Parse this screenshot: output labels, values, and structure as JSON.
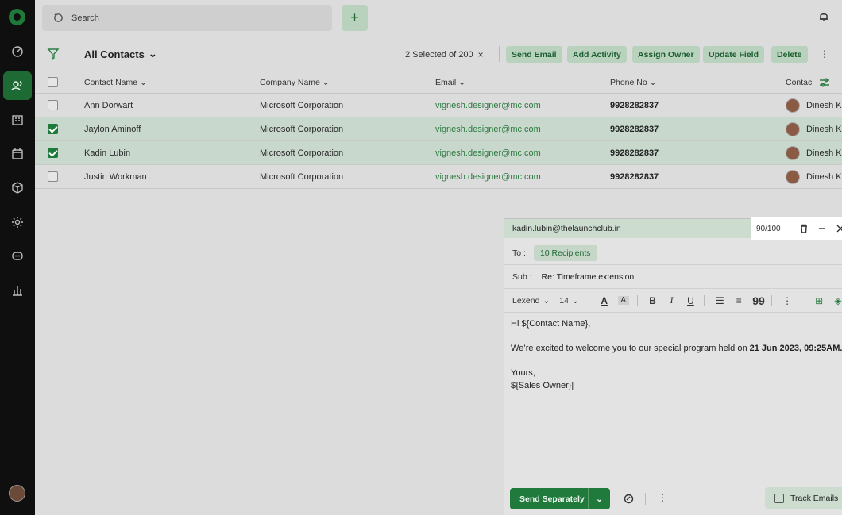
{
  "search": {
    "label": "Search"
  },
  "toolbar": {
    "view_title": "All Contacts",
    "selected_info": "2 Selected of 200",
    "clear_icon": "×",
    "actions": [
      "Send Email",
      "Add Activity",
      "Assign Owner",
      "Update Field",
      "Delete"
    ]
  },
  "table": {
    "columns": [
      "Contact Name",
      "Company Name",
      "Email",
      "Phone No",
      "Contac"
    ],
    "rows": [
      {
        "name": "Ann Dorwart",
        "company": "Microsoft Corporation",
        "email": "vignesh.designer@mc.com",
        "phone": "9928282837",
        "owner": "Dinesh Ku",
        "selected": false
      },
      {
        "name": "Jaylon Aminoff",
        "company": "Microsoft Corporation",
        "email": "vignesh.designer@mc.com",
        "phone": "9928282837",
        "owner": "Dinesh Ku",
        "selected": true
      },
      {
        "name": "Kadin Lubin",
        "company": "Microsoft Corporation",
        "email": "vignesh.designer@mc.com",
        "phone": "9928282837",
        "owner": "Dinesh Ku",
        "selected": true
      },
      {
        "name": "Justin Workman",
        "company": "Microsoft Corporation",
        "email": "vignesh.designer@mc.com",
        "phone": "9928282837",
        "owner": "Dinesh Ku",
        "selected": false
      }
    ]
  },
  "compose": {
    "from": "kadin.lubin@thelaunchclub.in",
    "count": "90/100",
    "to_label": "To :",
    "recipients": "10 Recipients",
    "sub_label": "Sub :",
    "subject": "Re: Timeframe extension",
    "font": "Lexend",
    "font_size": "14",
    "body": {
      "greeting": "Hi ${Contact Name},",
      "line_prefix": "We’re excited to welcome you to our special program held on ",
      "line_bold": "21 Jun 2023, 09:25AM.",
      "closing": "Yours,",
      "signature": "${Sales Owner}|"
    },
    "send_label": "Send Separately",
    "track_label": "Track Emails"
  },
  "colors": {
    "accent": "#1f7a3b",
    "accent_light": "#b9d2be",
    "rail": "#0f0f0f",
    "selected_row": "#c9d8cc"
  },
  "icons": [
    "logo-icon",
    "dashboard-icon",
    "contacts-icon",
    "companies-icon",
    "calendar-icon",
    "products-icon",
    "settings-icon",
    "chat-icon",
    "reports-icon",
    "search-icon",
    "plus-icon",
    "bell-icon",
    "filter-icon",
    "chevron-down-icon",
    "close-icon",
    "kebab-icon",
    "column-settings-icon",
    "trash-icon",
    "minimize-icon",
    "bold-icon",
    "italic-icon",
    "underline-icon",
    "list-icon",
    "align-icon",
    "quote-icon",
    "template-icon",
    "layers-icon",
    "attachment-icon"
  ]
}
